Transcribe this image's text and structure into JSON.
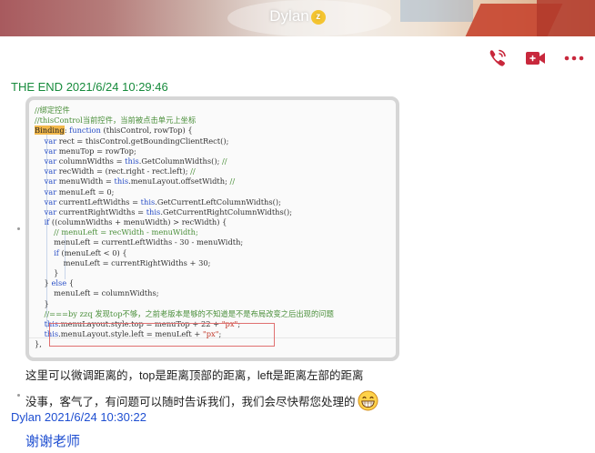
{
  "header": {
    "contact_name": "Dylan",
    "status_badge": "z"
  },
  "toolbar": {
    "icons": [
      "phone-icon",
      "video-call-icon",
      "more-icon"
    ],
    "accent_color": "#c8283c"
  },
  "messages": [
    {
      "sender": "THE END",
      "timestamp": "2021/6/24 10:29:46",
      "sender_color": "#178b3c"
    },
    {
      "sender": "Dylan",
      "timestamp": "2021/6/24 10:30:22",
      "sender_color": "#1f4fd1"
    }
  ],
  "code_screenshot": {
    "lines": [
      "//绑定控件",
      "//thisControl当前控件，当前被点击单元上坐标",
      "Binding: function (thisControl, rowTop) {",
      "    var rect = thisControl.getBoundingClientRect();",
      "    var menuTop = rowTop;",
      "    var columnWidths = this.GetColumnWidths(); //",
      "    var recWidth = (rect.right - rect.left); //",
      "    var menuWidth = this.menuLayout.offsetWidth; //",
      "    var menuLeft = 0;",
      "    var currentLeftWidths = this.GetCurrentLeftColumnWidths();",
      "    var currentRightWidths = this.GetCurrentRightColumnWidths();",
      "    if ((columnWidths + menuWidth) > recWidth) {",
      "        // menuLeft = recWidth - menuWidth;",
      "        menuLeft = currentLeftWidths - 30 - menuWidth;",
      "        if (menuLeft < 0) {",
      "            menuLeft = currentRightWidths + 30;",
      "        }",
      "    } else {",
      "        menuLeft = columnWidths;",
      "    }",
      "    //===by zzq 发现top不够，之前老版本是够的不知道是不是布局改变之后出现的问题",
      "    this.menuLayout.style.top = menuTop + 22 + \"px\";",
      "    this.menuLayout.style.left = menuLeft + \"px\";",
      "},"
    ]
  },
  "chat_texts": {
    "reply_1": "这里可以微调距离的，top是距离顶部的距离，left是距离左部的距离",
    "reply_2": "没事，客气了，有问题可以随时告诉我们，我们会尽快帮您处理的",
    "reply_2_emoji": "grin-emoji-icon",
    "dylan_reply": "谢谢老师"
  }
}
